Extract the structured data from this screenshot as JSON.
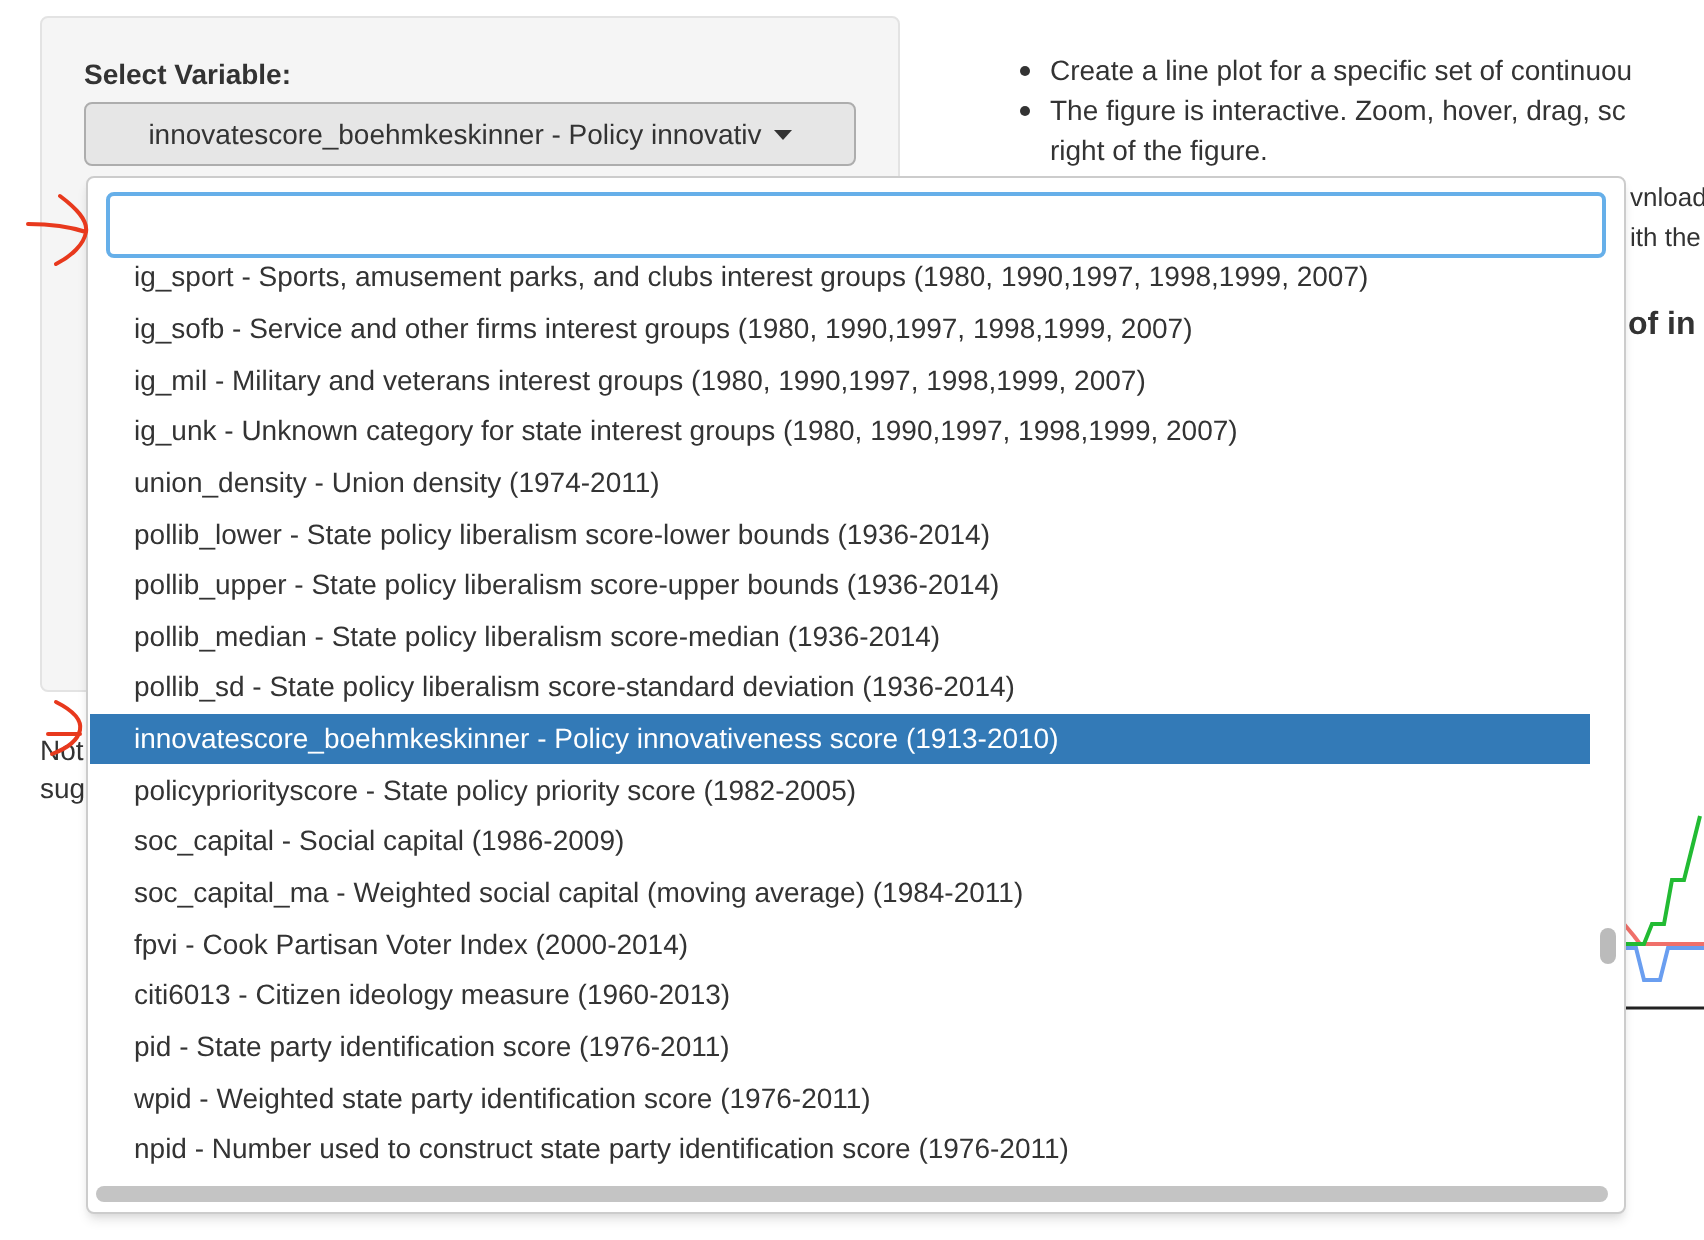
{
  "sidebar": {
    "label": "Select Variable:",
    "select": {
      "value": "innovatescore_boehmkeskinner - Policy innovativ"
    },
    "note_fragments": [
      "Not",
      "sug"
    ]
  },
  "info": {
    "bullets": [
      "Create a line plot for a specific set of continuou",
      "The figure is interactive. Zoom, hover, drag, sc right of the figure."
    ],
    "fragments": [
      "vnload",
      "ith the"
    ],
    "heading_fragment": "of in"
  },
  "dropdown": {
    "options": [
      {
        "label": "ig_sport - Sports, amusement parks, and clubs interest groups (1980, 1990,1997, 1998,1999, 2007)",
        "selected": false
      },
      {
        "label": "ig_sofb - Service and other firms interest groups (1980, 1990,1997, 1998,1999, 2007)",
        "selected": false
      },
      {
        "label": "ig_mil - Military and veterans interest groups (1980, 1990,1997, 1998,1999, 2007)",
        "selected": false
      },
      {
        "label": "ig_unk - Unknown category for state interest groups (1980, 1990,1997, 1998,1999, 2007)",
        "selected": false
      },
      {
        "label": "union_density - Union density (1974-2011)",
        "selected": false
      },
      {
        "label": "pollib_lower - State policy liberalism score-lower bounds (1936-2014)",
        "selected": false
      },
      {
        "label": "pollib_upper - State policy liberalism score-upper bounds (1936-2014)",
        "selected": false
      },
      {
        "label": "pollib_median - State policy liberalism score-median (1936-2014)",
        "selected": false
      },
      {
        "label": "pollib_sd - State policy liberalism score-standard deviation (1936-2014)",
        "selected": false
      },
      {
        "label": "innovatescore_boehmkeskinner - Policy innovativeness score (1913-2010)",
        "selected": true
      },
      {
        "label": "policypriorityscore - State policy priority score (1982-2005)",
        "selected": false
      },
      {
        "label": "soc_capital - Social capital (1986-2009)",
        "selected": false
      },
      {
        "label": "soc_capital_ma - Weighted social capital (moving average) (1984-2011)",
        "selected": false
      },
      {
        "label": "fpvi - Cook Partisan Voter Index (2000-2014)",
        "selected": false
      },
      {
        "label": "citi6013 - Citizen ideology measure (1960-2013)",
        "selected": false
      },
      {
        "label": "pid - State party identification score (1976-2011)",
        "selected": false
      },
      {
        "label": "wpid - Weighted state party identification score (1976-2011)",
        "selected": false
      },
      {
        "label": "npid - Number used to construct state party identification score (1976-2011)",
        "selected": false
      }
    ]
  }
}
